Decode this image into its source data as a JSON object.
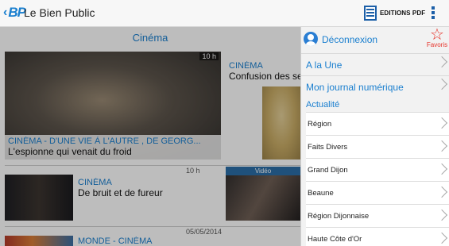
{
  "actionbar": {
    "logo_text": "BP",
    "title": "Le Bien Public",
    "pdf_label": "EDITIONS PDF"
  },
  "content": {
    "section_title": "Cinéma",
    "cards": [
      {
        "kicker": "CINÉMA - D'UNE VIE À L'AUTRE , DE GEORG...",
        "headline": "L'espionne qui venait du froid",
        "time": "10 h"
      },
      {
        "kicker": "CINÉMA",
        "headline": "Confusion des sen"
      },
      {
        "kicker": "CINÉMA",
        "headline": "De bruit et de fureur",
        "time": "10 h",
        "badge": "Vidéo"
      },
      {
        "kicker": "MONDE - CINÉMA",
        "date": "05/05/2014"
      }
    ]
  },
  "drawer": {
    "login_label": "Déconnexion",
    "favorites_label": "Favoris",
    "main_items": [
      {
        "label": "A la Une"
      },
      {
        "label": "Mon journal numérique"
      }
    ],
    "section_label": "Actualité",
    "sub_items": [
      {
        "label": "Région"
      },
      {
        "label": "Faits Divers"
      },
      {
        "label": "Grand Dijon"
      },
      {
        "label": "Beaune"
      },
      {
        "label": "Région Dijonnaise"
      },
      {
        "label": "Haute Côte d'Or"
      }
    ]
  },
  "colors": {
    "accent": "#1a7fcf",
    "favorites": "#e6332a",
    "pdf_icon": "#1c5fa8"
  }
}
